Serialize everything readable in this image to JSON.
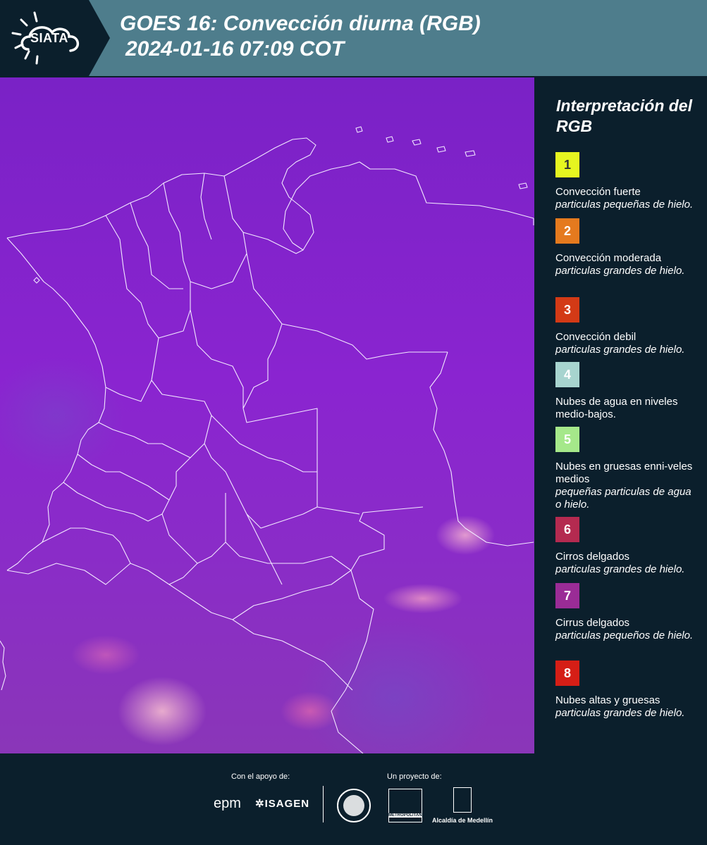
{
  "header": {
    "logo_text": "SIATA",
    "title_line1": "GOES 16: Convección diurna (RGB)",
    "title_line2": "2024-01-16 07:09 COT",
    "background_color": "#4e7d8c"
  },
  "legend": {
    "title": "Interpretación del RGB",
    "items": [
      {
        "number": "1",
        "color": "#e6f520",
        "text_color": "#333333",
        "main": "Convección fuerte",
        "sub": "particulas pequeñas de hielo."
      },
      {
        "number": "2",
        "color": "#e57a1e",
        "text_color": "#ffffff",
        "main": "Convección moderada",
        "sub": "particulas grandes de hielo."
      },
      {
        "number": "3",
        "color": "#d33a16",
        "text_color": "#ffffff",
        "main": "Convección debil",
        "sub": "particulas grandes de hielo."
      },
      {
        "number": "4",
        "color": "#a7d4cf",
        "text_color": "#ffffff",
        "main": "Nubes de agua en niveles medio-bajos.",
        "sub": ""
      },
      {
        "number": "5",
        "color": "#a5e88a",
        "text_color": "#ffffff",
        "main": "Nubes en gruesas enni-veles medios",
        "sub": "pequeñas particulas de agua o hielo."
      },
      {
        "number": "6",
        "color": "#b42a50",
        "text_color": "#ffffff",
        "main": "Cirros delgados",
        "sub": "particulas grandes de hielo."
      },
      {
        "number": "7",
        "color": "#9a2c96",
        "text_color": "#ffffff",
        "main": "Cirrus delgados",
        "sub": "particulas pequeños de hielo."
      },
      {
        "number": "8",
        "color": "#d51e16",
        "text_color": "#ffffff",
        "main": "Nubes altas y gruesas",
        "sub": "particulas grandes de hielo."
      }
    ]
  },
  "footer": {
    "support_label": "Con el apoyo de:",
    "project_label": "Un proyecto de:",
    "sponsors": [
      "epm",
      "ISAGEN"
    ],
    "area_text": "METROPOLITANA",
    "alcaldia_text": "Alcaldía de Medellín"
  }
}
